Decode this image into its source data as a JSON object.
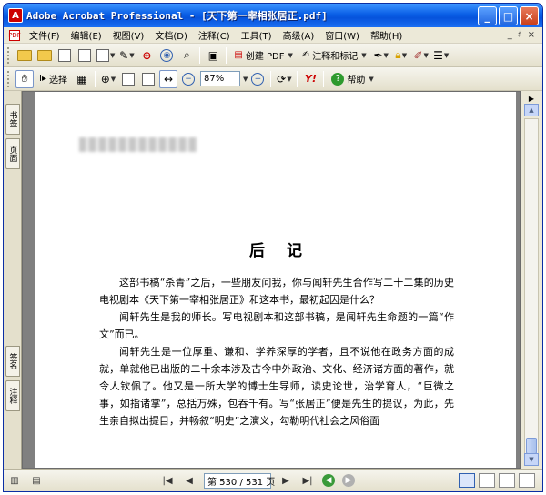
{
  "window": {
    "title": "Adobe Acrobat Professional - [天下第一宰相张居正.pdf]",
    "app_icon": "A",
    "buttons": {
      "minimize": "_",
      "maximize": "□",
      "close": "×"
    }
  },
  "menu": {
    "icon": "PDF",
    "items": [
      "文件(F)",
      "编辑(E)",
      "视图(V)",
      "文档(D)",
      "注释(C)",
      "工具(T)",
      "高级(A)",
      "窗口(W)",
      "帮助(H)"
    ],
    "right_controls": [
      "_",
      "♯",
      "×"
    ]
  },
  "toolbar1": {
    "create_pdf": "创建 PDF",
    "comment_markup": "注释和标记"
  },
  "toolbar2": {
    "select": "选择",
    "zoom": "87%",
    "help": "帮助"
  },
  "sidebar": {
    "tabs": [
      "书签",
      "页面",
      "签名",
      "注释"
    ]
  },
  "document": {
    "heading": "后记",
    "paragraphs": [
      "这部书稿“杀青”之后，一些朋友问我，你与闻轩先生合作写二十二集的历史电视剧本《天下第一宰相张居正》和这本书，最初起因是什么？",
      "闻轩先生是我的师长。写电视剧本和这部书稿，是闻轩先生命题的一篇“作文”而已。",
      "闻轩先生是一位厚重、谦和、学养深厚的学者，且不说他在政务方面的成就，单就他已出版的二十余本涉及古今中外政治、文化、经济诸方面的著作，就令人钦佩了。他又是一所大学的博士生导师，读史论世，治学育人，“巨微之事，如指诸掌”，总括万殊，包吞千有。写“张居正”便是先生的提议，为此，先生亲自拟出提目，并畅叙“明史”之演义，勾勒明代社会之风俗面"
    ]
  },
  "status": {
    "page_indicator": "第 530 / 531 页"
  }
}
